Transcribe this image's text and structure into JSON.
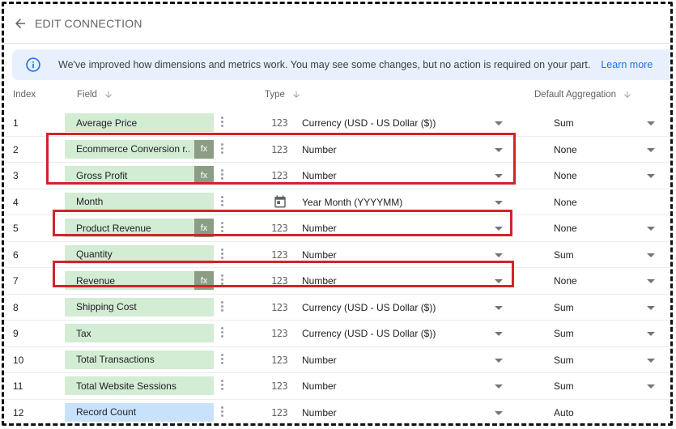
{
  "header": {
    "title": "EDIT CONNECTION",
    "back_icon": "arrow-left-icon"
  },
  "banner": {
    "message": "We've improved how dimensions and metrics work. You may see some changes, but no action is required on your part.",
    "link": "Learn more",
    "icon": "info-icon",
    "color": "#e8f0fe"
  },
  "columns": {
    "index": "Index",
    "field": "Field",
    "type": "Type",
    "aggregation": "Default Aggregation"
  },
  "rows": [
    {
      "index": "1",
      "field": "Average Price",
      "fx": "",
      "type": "Currency (USD - US Dollar ($))",
      "type_icon": "123",
      "aggregation": "Sum",
      "agg_dropdown": true
    },
    {
      "index": "2",
      "field": "Ecommerce Conversion r...",
      "fx": "fx",
      "type": "Number",
      "type_icon": "123",
      "aggregation": "None",
      "agg_dropdown": true
    },
    {
      "index": "3",
      "field": "Gross Profit",
      "fx": "fx",
      "type": "Number",
      "type_icon": "123",
      "aggregation": "None",
      "agg_dropdown": true
    },
    {
      "index": "4",
      "field": "Month",
      "fx": "",
      "type": "Year Month (YYYYMM)",
      "type_icon": "calendar",
      "aggregation": "None",
      "agg_dropdown": false
    },
    {
      "index": "5",
      "field": "Product Revenue",
      "fx": "fx",
      "type": "Number",
      "type_icon": "123",
      "aggregation": "None",
      "agg_dropdown": true
    },
    {
      "index": "6",
      "field": "Quantity",
      "fx": "",
      "type": "Number",
      "type_icon": "123",
      "aggregation": "Sum",
      "agg_dropdown": true
    },
    {
      "index": "7",
      "field": "Revenue",
      "fx": "fx",
      "type": "Number",
      "type_icon": "123",
      "aggregation": "None",
      "agg_dropdown": true
    },
    {
      "index": "8",
      "field": "Shipping Cost",
      "fx": "",
      "type": "Currency (USD - US Dollar ($))",
      "type_icon": "123",
      "aggregation": "Sum",
      "agg_dropdown": true
    },
    {
      "index": "9",
      "field": "Tax",
      "fx": "",
      "type": "Currency (USD - US Dollar ($))",
      "type_icon": "123",
      "aggregation": "Sum",
      "agg_dropdown": true
    },
    {
      "index": "10",
      "field": "Total Transactions",
      "fx": "",
      "type": "Number",
      "type_icon": "123",
      "aggregation": "Sum",
      "agg_dropdown": true
    },
    {
      "index": "11",
      "field": "Total Website Sessions",
      "fx": "",
      "type": "Number",
      "type_icon": "123",
      "aggregation": "Sum",
      "agg_dropdown": true
    },
    {
      "index": "12",
      "field": "Record Count",
      "fx": "",
      "type": "Number",
      "type_icon": "123",
      "aggregation": "Auto",
      "agg_dropdown": false,
      "chip_color": "blue"
    }
  ],
  "colors": {
    "metric_chip": "#d3ecd4",
    "fx_badge": "#8b9e85",
    "record_count_chip": "#c9e2fc",
    "highlight": "#d2232a"
  }
}
